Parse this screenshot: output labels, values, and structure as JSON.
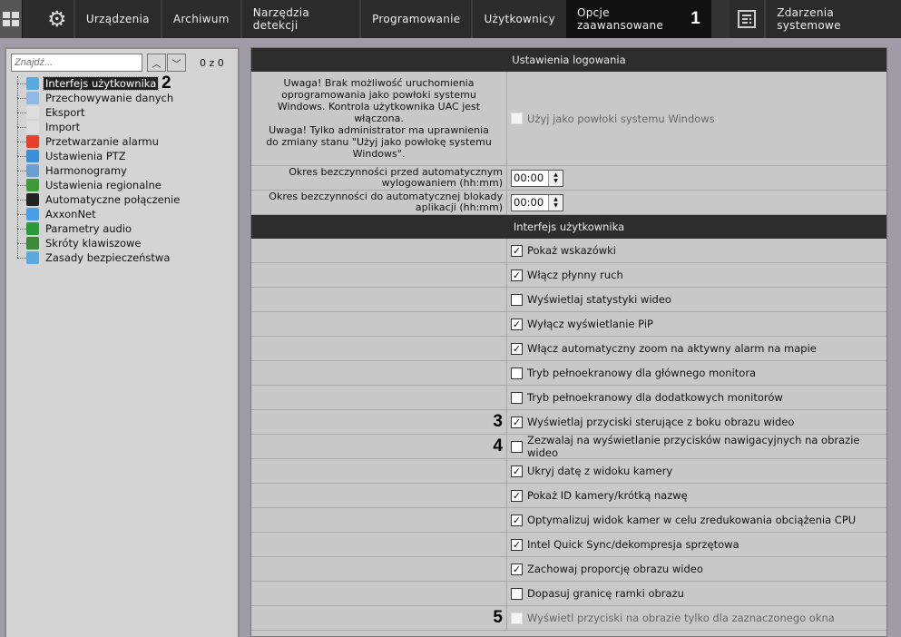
{
  "topbar": {
    "items": [
      "Urządzenia",
      "Archiwum",
      "Narzędzia detekcji",
      "Programowanie",
      "Użytkownicy",
      "Opcje zaawansowane",
      "Zdarzenia systemowe"
    ],
    "active": "Opcje zaawansowane",
    "marker": "1"
  },
  "left": {
    "search_placeholder": "Znajdź...",
    "count": "0 z 0",
    "marker": "2",
    "items": [
      "Interfejs użytkownika",
      "Przechowywanie danych",
      "Eksport",
      "Import",
      "Przetwarzanie alarmu",
      "Ustawienia PTZ",
      "Harmonogramy",
      "Ustawienia regionalne",
      "Automatyczne połączenie",
      "AxxonNet",
      "Parametry audio",
      "Skróty klawiszowe",
      "Zasady bezpieczeństwa"
    ]
  },
  "logging": {
    "title": "Ustawienia logowania",
    "warning": "Uwaga! Brak możliwość uruchomienia oprogramowania jako powłoki systemu Windows. Kontrola użytkownika UAC jest włączona.\nUwaga! Tylko administrator ma uprawnienia do zmiany stanu \"Użyj jako powłokę systemu Windows\".",
    "shell_label": "Użyj jako powłoki systemu Windows",
    "logout_label": "Okres bezczynności przed automatycznym wylogowaniem (hh:mm)",
    "logout_value": "00:00",
    "lock_label": "Okres bezczynności do automatycznej blokady aplikacji (hh:mm)",
    "lock_value": "00:00"
  },
  "ui": {
    "title": "Interfejs użytkownika",
    "options": [
      {
        "label": "Pokaż wskazówki",
        "checked": true
      },
      {
        "label": "Włącz płynny ruch",
        "checked": true
      },
      {
        "label": "Wyświetlaj statystyki wideo",
        "checked": false
      },
      {
        "label": "Wyłącz wyświetlanie PiP",
        "checked": true
      },
      {
        "label": "Włącz automatyczny zoom na aktywny alarm na mapie",
        "checked": true
      },
      {
        "label": "Tryb pełnoekranowy dla głównego monitora",
        "checked": false
      },
      {
        "label": "Tryb pełnoekranowy dla dodatkowych monitorów",
        "checked": false
      },
      {
        "label": "Wyświetlaj przyciski sterujące z boku obrazu wideo",
        "checked": true,
        "marker": "3"
      },
      {
        "label": "Zezwalaj na wyświetlanie przycisków nawigacyjnych na obrazie wideo",
        "checked": false,
        "marker": "4"
      },
      {
        "label": "Ukryj datę z widoku kamery",
        "checked": true
      },
      {
        "label": "Pokaż ID kamery/krótką nazwę",
        "checked": true
      },
      {
        "label": "Optymalizuj widok kamer w celu zredukowania obciążenia CPU",
        "checked": true
      },
      {
        "label": "Intel Quick Sync/dekompresja sprzętowa",
        "checked": true
      },
      {
        "label": "Zachowaj proporcję obrazu wideo",
        "checked": true
      },
      {
        "label": "Dopasuj granicę ramki obrazu",
        "checked": false
      },
      {
        "label": "Wyświetl przyciski na obrazie tylko dla zaznaczonego okna",
        "checked": false,
        "disabled": true,
        "marker": "5"
      }
    ]
  }
}
